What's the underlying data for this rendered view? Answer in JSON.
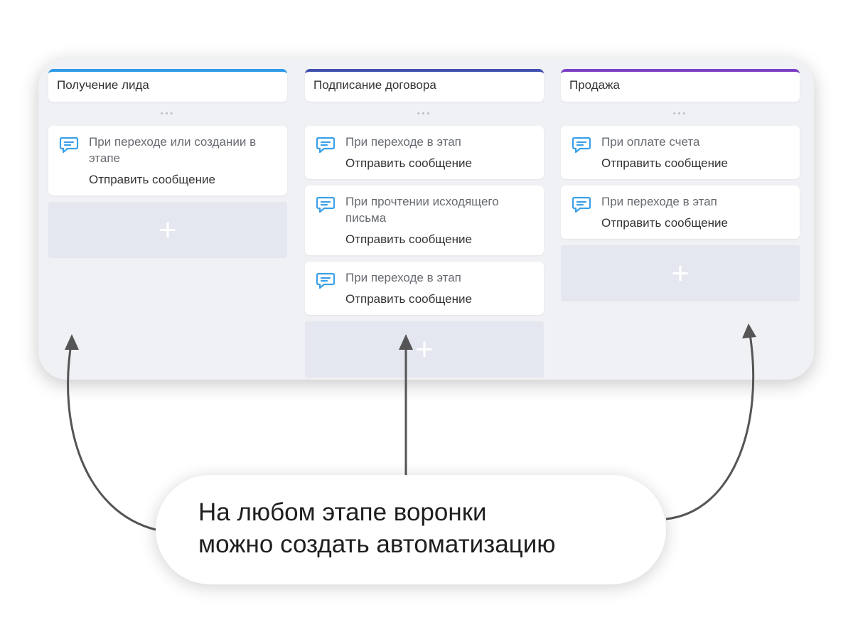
{
  "pipeline": {
    "columns": [
      {
        "title": "Получение лида",
        "accent": "#2f9ae8",
        "cards": [
          {
            "trigger": "При переходе или создании в этапе",
            "action": "Отправить сообщение"
          }
        ]
      },
      {
        "title": "Подписание договора",
        "accent": "#3f4fae",
        "cards": [
          {
            "trigger": "При переходе в этап",
            "action": "Отправить сообщение"
          },
          {
            "trigger": "При прочтении исходящего письма",
            "action": "Отправить сообщение"
          },
          {
            "trigger": "При переходе в этап",
            "action": "Отправить сообщение"
          }
        ]
      },
      {
        "title": "Продажа",
        "accent": "#7c3fc4",
        "cards": [
          {
            "trigger": "При оплате счета",
            "action": "Отправить сообщение"
          },
          {
            "trigger": "При переходе в этап",
            "action": "Отправить сообщение"
          }
        ]
      }
    ],
    "drag_handle": "•••",
    "add_symbol": "+",
    "card_icon": "chat-message-icon",
    "icon_color": "#3aa0e8"
  },
  "callout": {
    "text_line1": "На любом этапе воронки",
    "text_line2": "можно создать автоматизацию"
  },
  "colors": {
    "panel_bg": "#f0f1f5",
    "add_slot_bg": "#e4e7ef",
    "arrow": "#555555"
  }
}
